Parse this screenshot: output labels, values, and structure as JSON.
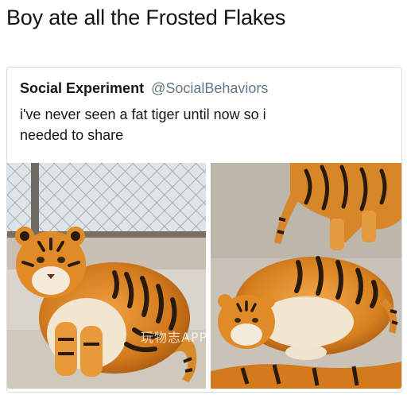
{
  "caption": "Boy ate all the Frosted Flakes",
  "tweet": {
    "display_name": "Social Experiment",
    "handle": "@SocialBehaviors",
    "text_line1": "i've never seen a fat tiger until now so i",
    "text_line2": "needed to share"
  },
  "images": [
    {
      "description_icon": "tiger-sitting-photo"
    },
    {
      "description_icon": "tiger-lying-photo"
    }
  ],
  "watermark": "玩物志APP",
  "colors": {
    "tiger_orange": "#d9821f",
    "stripe": "#2a1a0e",
    "fence": "#8a8f95",
    "ground": "#bfb5a6",
    "handle_gray": "#657786"
  }
}
